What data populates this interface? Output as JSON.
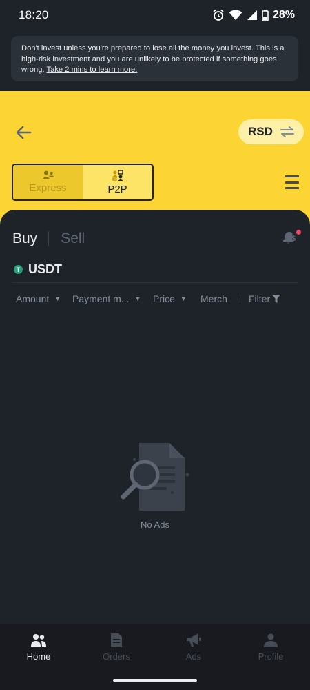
{
  "status_bar": {
    "time": "18:20",
    "battery": "28%"
  },
  "warning": {
    "text": "Don't invest unless you're prepared to lose all the money you invest. This is a high-risk investment and you are unlikely to be protected if something goes wrong.",
    "link": "Take 2 mins to learn more."
  },
  "header": {
    "currency": "RSD"
  },
  "mode": {
    "express_label": "Express",
    "p2p_label": "P2P",
    "selected": "P2P"
  },
  "trade_tabs": {
    "buy_label": "Buy",
    "sell_label": "Sell",
    "selected": "Buy"
  },
  "asset": {
    "icon_letter": "T",
    "name": "USDT",
    "color": "#26A17B"
  },
  "filters": {
    "amount": "Amount",
    "payment": "Payment m...",
    "price": "Price",
    "merchant": "Merch",
    "filter": "Filter"
  },
  "empty_state": {
    "label": "No Ads"
  },
  "bottom_nav": {
    "items": [
      {
        "label": "Home",
        "icon": "home-icon",
        "active": true
      },
      {
        "label": "Orders",
        "icon": "orders-icon",
        "active": false
      },
      {
        "label": "Ads",
        "icon": "megaphone-icon",
        "active": false
      },
      {
        "label": "Profile",
        "icon": "profile-icon",
        "active": false
      }
    ]
  },
  "colors": {
    "brand_yellow": "#FCD535",
    "background": "#1E2329",
    "alert_red": "#F6465D"
  }
}
